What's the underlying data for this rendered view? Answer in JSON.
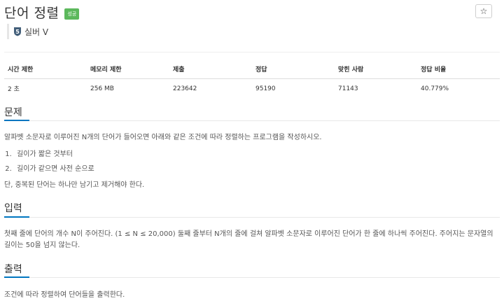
{
  "problem": {
    "title": "단어 정렬",
    "status_badge": "성공",
    "star_glyph": "☆",
    "tier": "실버 V",
    "tier_number": "5",
    "tier_color": "#435f7a"
  },
  "stats": {
    "headers": [
      "시간 제한",
      "메모리 제한",
      "제출",
      "정답",
      "맞힌 사람",
      "정답 비율"
    ],
    "values": [
      "2 초",
      "256 MB",
      "223642",
      "95190",
      "71143",
      "40.779%"
    ]
  },
  "sections": {
    "problem_title": "문제",
    "problem_text": "알파벳 소문자로 이루어진 N개의 단어가 들어오면 아래와 같은 조건에 따라 정렬하는 프로그램을 작성하시오.",
    "conditions": [
      "길이가 짧은 것부터",
      "길이가 같으면 사전 순으로"
    ],
    "note": "단, 중복된 단어는 하나만 남기고 제거해야 한다.",
    "input_title": "입력",
    "input_text": "첫째 줄에 단어의 개수 N이 주어진다. (1 ≤ N ≤ 20,000) 둘째 줄부터 N개의 줄에 걸쳐 알파벳 소문자로 이루어진 단어가 한 줄에 하나씩 주어진다. 주어지는 문자열의 길이는 50을 넘지 않는다.",
    "output_title": "출력",
    "output_text": "조건에 따라 정렬하여 단어들을 출력한다."
  },
  "colors": {
    "accent": "#0076c0",
    "success": "#5cb85c"
  }
}
